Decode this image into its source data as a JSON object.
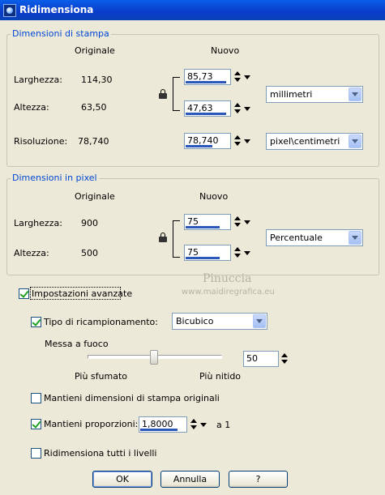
{
  "window": {
    "title": "Ridimensiona",
    "icon": "paintshop-icon"
  },
  "print_size": {
    "legend": "Dimensioni di stampa",
    "col_original": "Originale",
    "col_new": "Nuovo",
    "width": {
      "label": "Larghezza:",
      "original": "114,30",
      "new": "85,73",
      "fill": 0.9
    },
    "height": {
      "label": "Altezza:",
      "original": "63,50",
      "new": "47,63",
      "fill": 0.9
    },
    "resolution": {
      "label": "Risoluzione:",
      "original": "78,740",
      "new": "78,740",
      "fill": 0.6
    },
    "unit": "millimetri",
    "res_unit": "pixel\\centimetri"
  },
  "pixel_size": {
    "legend": "Dimensioni in pixel",
    "col_original": "Originale",
    "col_new": "Nuovo",
    "width": {
      "label": "Larghezza:",
      "original": "900",
      "new": "75",
      "fill": 0.75
    },
    "height": {
      "label": "Altezza:",
      "original": "500",
      "new": "75",
      "fill": 0.75
    },
    "unit": "Percentuale"
  },
  "advanced": {
    "label": "Impostazioni avanzate",
    "checked": true,
    "resample": {
      "label": "Tipo di ricampionamento:",
      "checked": true,
      "value": "Bicubico"
    },
    "sharpness": {
      "label": "Messa a fuoco",
      "min_label": "Più sfumato",
      "max_label": "Più nitido",
      "value": "50",
      "level": 0.5
    },
    "keep_print": {
      "label": "Mantieni dimensioni di stampa originali",
      "checked": false
    },
    "keep_ratio": {
      "label": "Mantieni proporzioni:",
      "checked": true,
      "value": "1,8000",
      "suffix": "a 1",
      "fill": 0.8
    },
    "resize_all": {
      "label": "Ridimensiona tutti i livelli",
      "checked": false
    }
  },
  "watermark": {
    "line1": "Pinuccia",
    "line2": "www.maidiregrafica.eu"
  },
  "buttons": {
    "ok": "OK",
    "cancel": "Annulla",
    "help": "?"
  }
}
